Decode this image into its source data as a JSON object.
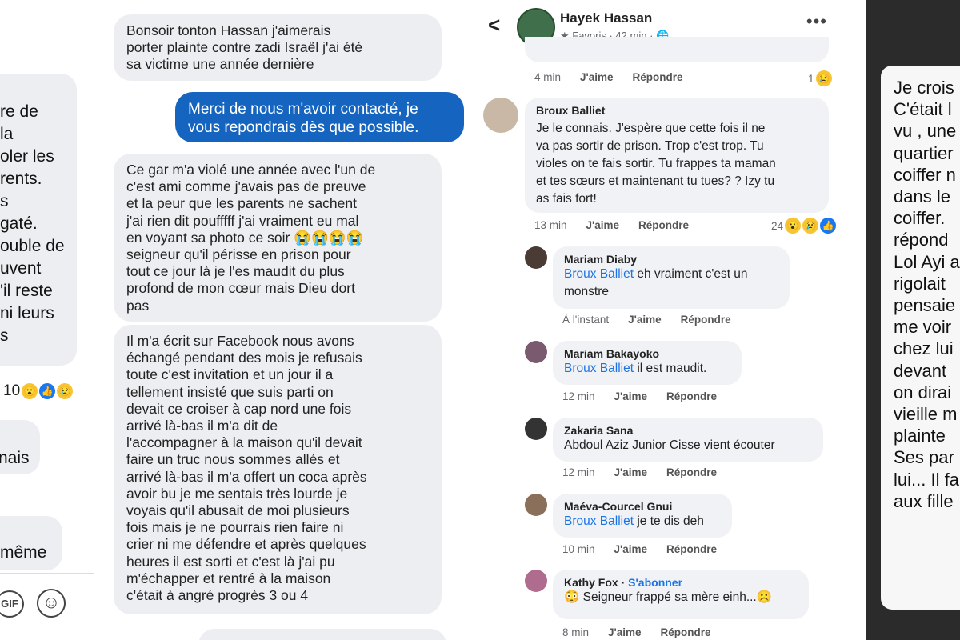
{
  "panel1": {
    "lines": [
      "re de",
      "la",
      "oler les",
      "rents.",
      "s",
      "gaté.",
      "ouble de",
      "uvent",
      "'il reste",
      "ni leurs",
      "s"
    ],
    "reaction_count": "10",
    "fragment1": "nais",
    "fragment2": "même",
    "gif_label": "GIF"
  },
  "panel2": {
    "msg1": [
      "Bonsoir tonton Hassan j'aimerais",
      "porter plainte contre zadi Israël j'ai été",
      "sa victime une année dernière"
    ],
    "reply": [
      "Merci de nous m'avoir contacté, je",
      "vous repondrais dès que possible."
    ],
    "msg2": [
      "Ce gar m'a violé une année avec l'un de",
      "c'est ami comme j'avais pas de preuve",
      "et la peur que les parents ne sachent",
      "j'ai rien dit poufffff j'ai vraiment eu mal",
      "en voyant sa photo ce soir 😭😭😭😭",
      "seigneur qu'il périsse en prison pour",
      "tout ce jour là je l'es maudit du plus",
      "profond de mon cœur mais Dieu dort",
      "pas"
    ],
    "msg3": [
      "Il m'a écrit sur Facebook nous avons",
      "échangé pendant des mois je refusais",
      "toute c'est invitation et un jour il a",
      "tellement insisté que suis parti on",
      "devait ce croiser à cap nord une fois",
      "arrivé là-bas il m'a dit de",
      "l'accompagner à la maison qu'il devait",
      "faire un truc nous sommes allés et",
      "arrivé là-bas il m'a offert un coca après",
      "avoir bu je me sentais très lourde je",
      "voyais qu'il abusait de moi plusieurs",
      "fois mais je ne pourrais rien faire ni",
      "crier ni me défendre et après quelques",
      "heures il est sorti et c'est là j'ai pu",
      "m'échapper et rentré à la maison",
      "c'était à angré progrès 3 ou 4"
    ]
  },
  "panel3": {
    "header": {
      "name": "Hayek Hassan",
      "meta": "★ Favoris · 42 min · 🌐"
    },
    "top_actions": {
      "time": "4 min",
      "like": "J'aime",
      "reply": "Répondre",
      "count": "1"
    },
    "comments": [
      {
        "name": "Broux Balliet",
        "lines": [
          "Je le connais. J'espère que cette fois il ne",
          "va pas sortir de prison. Trop c'est trop. Tu",
          "violes on te fais sortir. Tu frappes ta maman",
          "et tes sœurs et maintenant tu tues? ? Izy tu",
          "as fais fort!"
        ],
        "time": "13 min",
        "like": "J'aime",
        "reply": "Répondre",
        "reactions": "24"
      },
      {
        "name": "Mariam Diaby",
        "mention": "Broux Balliet",
        "text": " eh vraiment c'est un",
        "text2": "monstre",
        "time": "À l'instant",
        "like": "J'aime",
        "reply": "Répondre"
      },
      {
        "name": "Mariam Bakayoko",
        "mention": "Broux Balliet",
        "text": " il est maudit.",
        "time": "12 min",
        "like": "J'aime",
        "reply": "Répondre"
      },
      {
        "name": "Zakaria Sana",
        "text": "Abdoul Aziz Junior Cisse vient écouter",
        "time": "12 min",
        "like": "J'aime",
        "reply": "Répondre"
      },
      {
        "name": "Maéva-Courcel Gnui",
        "mention": "Broux Balliet",
        "text": " je te dis deh",
        "time": "10 min",
        "like": "J'aime",
        "reply": "Répondre"
      },
      {
        "name": "Kathy Fox",
        "follow": "S'abonner",
        "text": "😳 Seigneur frappé sa mère einh...☹️",
        "time": "8 min",
        "like": "J'aime",
        "reply": "Répondre"
      }
    ]
  },
  "panel4": {
    "lines": [
      "Je crois",
      "C'était l",
      "vu , une",
      "quartier",
      "coiffer n",
      "dans le",
      "coiffer.",
      "répond",
      "Lol Ayi a",
      "rigolait",
      "pensaie",
      "me voir",
      "chez lui",
      "devant",
      "on dirai",
      "vieille m",
      "plainte",
      "Ses par",
      "lui... Il fa",
      "aux fille"
    ]
  },
  "colors": {
    "bubble_gray": "#eceef1",
    "bubble_blue": "#1565c0",
    "mention_blue": "#1b74e4"
  }
}
